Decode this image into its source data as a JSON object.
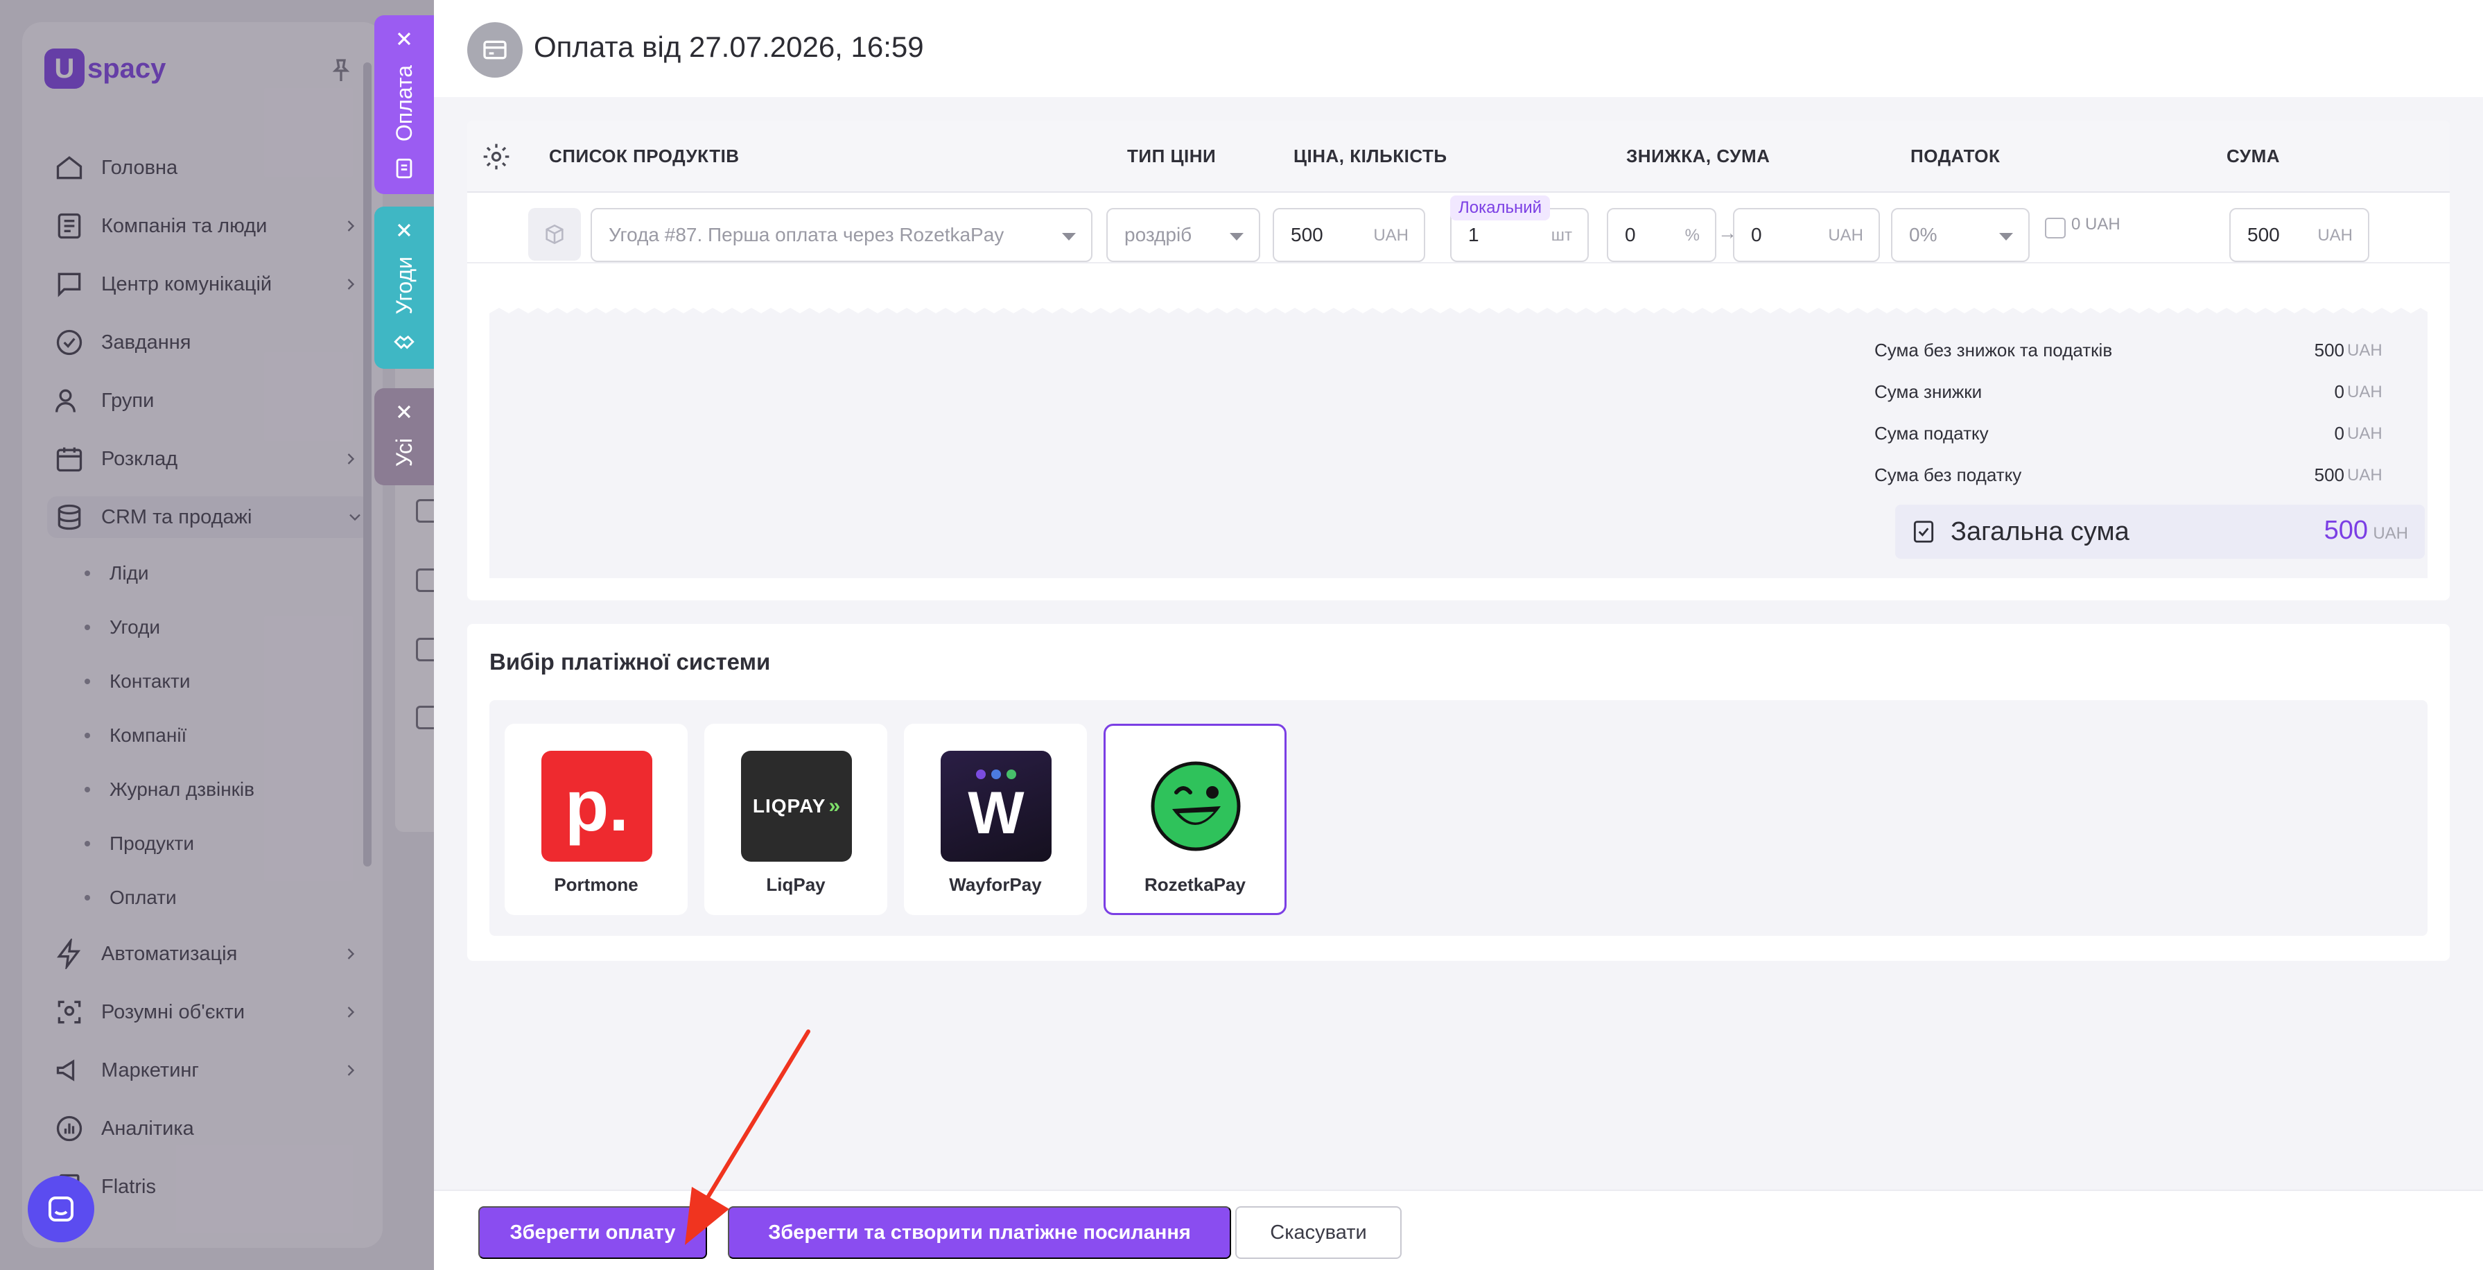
{
  "app": {
    "logo_text": "spacy",
    "logo_mark": "U",
    "sidebar": {
      "items": [
        {
          "label": "Головна",
          "icon": "home-icon"
        },
        {
          "label": "Компанія та люди",
          "icon": "org-icon"
        },
        {
          "label": "Центр комунікацій",
          "icon": "chat-icon"
        },
        {
          "label": "Завдання",
          "icon": "check-circle-icon"
        },
        {
          "label": "Групи",
          "icon": "users-icon"
        },
        {
          "label": "Розклад",
          "icon": "calendar-icon"
        },
        {
          "label": "CRM та продажі",
          "icon": "database-icon"
        },
        {
          "label": "Автоматизація",
          "icon": "bolt-icon"
        },
        {
          "label": "Розумні об'єкти",
          "icon": "scan-icon"
        },
        {
          "label": "Маркетинг",
          "icon": "megaphone-icon"
        },
        {
          "label": "Аналітика",
          "icon": "chart-icon"
        },
        {
          "label": "Flatris",
          "icon": "flatris-icon"
        }
      ],
      "crm_sub": [
        "Ліди",
        "Угоди",
        "Контакти",
        "Компанії",
        "Журнал дзвінків",
        "Продукти",
        "Оплати"
      ]
    }
  },
  "side_tabs": [
    {
      "label": "Оплата",
      "color": "#9b5cf2"
    },
    {
      "label": "Угоди",
      "color": "#3fb7c4"
    },
    {
      "label": "Усі",
      "color": "#8b7c93"
    }
  ],
  "drawer": {
    "title": "Оплата від 27.07.2026, 16:59",
    "table": {
      "headers": {
        "products": "СПИСОК ПРОДУКТІВ",
        "price_type": "ТИП ЦІНИ",
        "price_qty": "ЦІНА, КІЛЬКІСТЬ",
        "discount": "ЗНИЖКА, СУМА",
        "tax": "ПОДАТОК",
        "sum": "СУМА"
      },
      "row": {
        "product": "Угода #87. Перша оплата через RozetkaPay",
        "badge": "Локальний",
        "price_type": "роздріб",
        "price": "500",
        "price_unit": "UAH",
        "times": "×",
        "qty": "1",
        "qty_unit": "шт",
        "discount_pct": "0",
        "discount_pct_unit": "%",
        "arrow": "→",
        "discount_sum": "0",
        "discount_sum_unit": "UAH",
        "tax": "0%",
        "tax_amount": "0 UAH",
        "sum": "500",
        "sum_unit": "UAH"
      }
    },
    "totals": [
      {
        "label": "Сума без знижок та податків",
        "value": "500",
        "unit": "UAH"
      },
      {
        "label": "Сума знижки",
        "value": "0",
        "unit": "UAH"
      },
      {
        "label": "Сума податку",
        "value": "0",
        "unit": "UAH"
      },
      {
        "label": "Сума без податку",
        "value": "500",
        "unit": "UAH"
      }
    ],
    "grand_total": {
      "label": "Загальна сума",
      "value": "500",
      "unit": "UAH"
    },
    "payment": {
      "title": "Вибір платіжної системи",
      "options": [
        {
          "name": "Portmone",
          "logo_text": "p.",
          "selected": false
        },
        {
          "name": "LiqPay",
          "logo_text": "LIQPAY",
          "selected": false
        },
        {
          "name": "WayforPay",
          "logo_text": "W",
          "selected": false
        },
        {
          "name": "RozetkaPay",
          "logo_text": "",
          "selected": true
        }
      ]
    },
    "footer": {
      "save": "Зберегти оплату",
      "save_link": "Зберегти та створити платіжне посилання",
      "cancel": "Скасувати"
    }
  },
  "colors": {
    "accent": "#8a4df0",
    "annotation_arrow": "#f0341f"
  }
}
